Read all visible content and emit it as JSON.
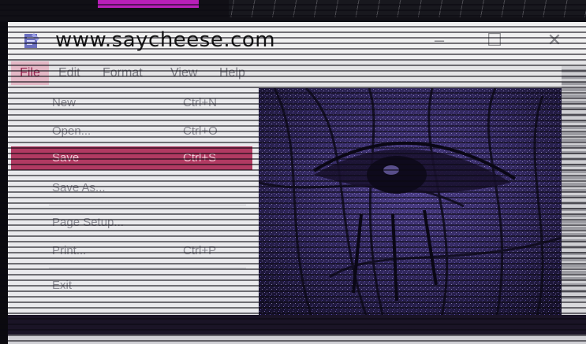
{
  "window": {
    "title": "www.saycheese.com",
    "minimize_symbol": "–",
    "maximize_symbol": "☐",
    "close_symbol": "✕"
  },
  "menubar": {
    "items": [
      {
        "label": "File"
      },
      {
        "label": "Edit"
      },
      {
        "label": "Format"
      },
      {
        "label": "View"
      },
      {
        "label": "Help"
      }
    ]
  },
  "file_menu": {
    "items": [
      {
        "label": "New",
        "shortcut": "Ctrl+N"
      },
      {
        "label": "Open...",
        "shortcut": "Ctrl+O"
      },
      {
        "label": "Save",
        "shortcut": "Ctrl+S",
        "highlighted": true
      },
      {
        "label": "Save As...",
        "shortcut": ""
      },
      {
        "label": "Page Setup...",
        "shortcut": ""
      },
      {
        "label": "Print...",
        "shortcut": "Ctrl+P"
      },
      {
        "label": "Exit",
        "shortcut": ""
      }
    ]
  },
  "icons": {
    "app": "notepad-icon",
    "image": "glitched-eye-image"
  },
  "colors": {
    "highlight": "#b13a62",
    "accent_magenta": "#b81fb8",
    "image_purple": "#2a1f4a"
  }
}
